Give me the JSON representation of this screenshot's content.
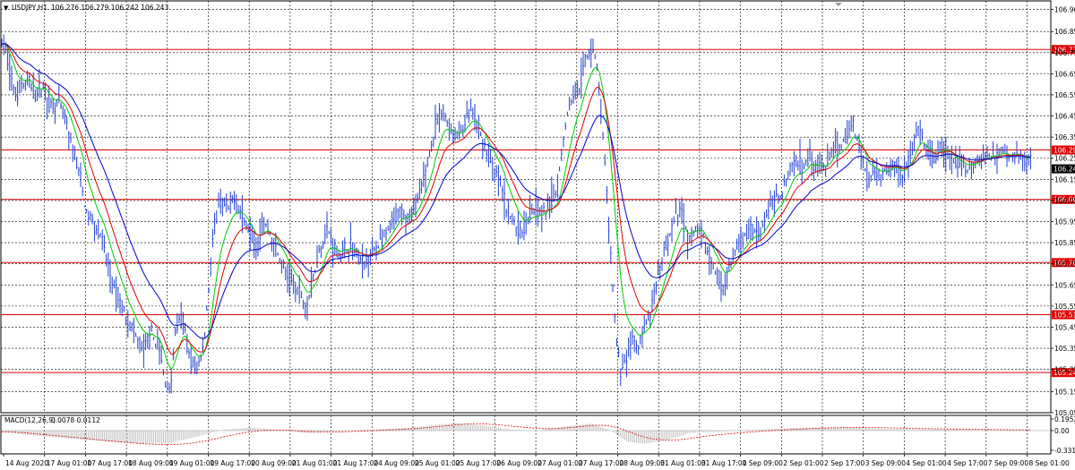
{
  "header": {
    "symbol_label": "USDJPY,H1",
    "ohlc": "106.276 106.279 106.242 106.243",
    "indicator_label": "MACD(12,26,9)",
    "indicator_values": "0.0078 0.0112"
  },
  "colors": {
    "candles": "#1f3fd0",
    "ma_fast": "#00cc00",
    "ma_mid": "#e00000",
    "ma_slow": "#0000cc",
    "levels": "#e00000",
    "grid": "#000000",
    "macd_hist": "#bdbdbd",
    "macd_signal": "#e00000"
  },
  "chart_data": [
    {
      "type": "line",
      "title": "USDJPY,H1",
      "ylim": [
        105.05,
        107.0
      ],
      "y_ticks": [
        "106.960",
        "106.855",
        "106.755",
        "106.655",
        "106.555",
        "106.455",
        "106.355",
        "106.255",
        "106.155",
        "106.055",
        "105.955",
        "105.855",
        "105.755",
        "105.655",
        "105.555",
        "105.455",
        "105.355",
        "105.255",
        "105.150",
        "105.050"
      ],
      "x_ticks": [
        "14 Aug 2020",
        "17 Aug 01:00",
        "17 Aug 17:00",
        "18 Aug 09:00",
        "19 Aug 01:00",
        "19 Aug 17:00",
        "20 Aug 09:00",
        "21 Aug 01:00",
        "21 Aug 17:00",
        "24 Aug 09:00",
        "25 Aug 01:00",
        "25 Aug 17:00",
        "26 Aug 09:00",
        "27 Aug 01:00",
        "27 Aug 17:00",
        "28 Aug 09:00",
        "31 Aug 01:00",
        "31 Aug 17:00",
        "1 Sep 09:00",
        "2 Sep 01:00",
        "2 Sep 17:00",
        "3 Sep 09:00",
        "4 Sep 01:00",
        "4 Sep 17:00",
        "7 Sep 09:00",
        "8 Sep 01:00"
      ],
      "levels": [
        {
          "value": 106.77,
          "label": "106.770"
        },
        {
          "value": 106.294,
          "label": "106.294"
        },
        {
          "value": 106.06,
          "label": "106.060"
        },
        {
          "value": 105.761,
          "label": "105.761"
        },
        {
          "value": 105.514,
          "label": "105.514"
        },
        {
          "value": 105.24,
          "label": "105.240"
        }
      ],
      "current_price": {
        "value": 106.243,
        "label": "106.243"
      },
      "price_path": [
        [
          0,
          106.82
        ],
        [
          8,
          106.75
        ],
        [
          16,
          106.55
        ],
        [
          24,
          106.6
        ],
        [
          32,
          106.62
        ],
        [
          40,
          106.55
        ],
        [
          48,
          106.6
        ],
        [
          56,
          106.5
        ],
        [
          64,
          106.52
        ],
        [
          72,
          106.45
        ],
        [
          80,
          106.3
        ],
        [
          88,
          106.2
        ],
        [
          96,
          106.0
        ],
        [
          104,
          105.95
        ],
        [
          112,
          105.9
        ],
        [
          120,
          105.75
        ],
        [
          128,
          105.62
        ],
        [
          136,
          105.55
        ],
        [
          144,
          105.48
        ],
        [
          152,
          105.4
        ],
        [
          160,
          105.35
        ],
        [
          168,
          105.42
        ],
        [
          176,
          105.38
        ],
        [
          184,
          105.2
        ],
        [
          190,
          105.15
        ],
        [
          196,
          105.45
        ],
        [
          204,
          105.5
        ],
        [
          212,
          105.3
        ],
        [
          220,
          105.25
        ],
        [
          228,
          105.4
        ],
        [
          234,
          105.7
        ],
        [
          240,
          105.95
        ],
        [
          246,
          106.05
        ],
        [
          254,
          106.0
        ],
        [
          262,
          106.08
        ],
        [
          270,
          105.98
        ],
        [
          278,
          105.92
        ],
        [
          286,
          105.85
        ],
        [
          294,
          105.95
        ],
        [
          302,
          105.9
        ],
        [
          310,
          105.8
        ],
        [
          318,
          105.72
        ],
        [
          326,
          105.66
        ],
        [
          334,
          105.62
        ],
        [
          342,
          105.55
        ],
        [
          350,
          105.7
        ],
        [
          358,
          105.85
        ],
        [
          366,
          105.92
        ],
        [
          374,
          105.82
        ],
        [
          382,
          105.8
        ],
        [
          390,
          105.85
        ],
        [
          398,
          105.8
        ],
        [
          406,
          105.75
        ],
        [
          414,
          105.8
        ],
        [
          422,
          105.85
        ],
        [
          430,
          105.88
        ],
        [
          438,
          105.95
        ],
        [
          446,
          106.0
        ],
        [
          454,
          105.98
        ],
        [
          462,
          106.0
        ],
        [
          470,
          106.1
        ],
        [
          478,
          106.25
        ],
        [
          486,
          106.4
        ],
        [
          494,
          106.48
        ],
        [
          502,
          106.4
        ],
        [
          510,
          106.35
        ],
        [
          518,
          106.42
        ],
        [
          526,
          106.48
        ],
        [
          534,
          106.38
        ],
        [
          542,
          106.3
        ],
        [
          550,
          106.2
        ],
        [
          558,
          106.15
        ],
        [
          566,
          106.0
        ],
        [
          574,
          105.95
        ],
        [
          582,
          105.9
        ],
        [
          590,
          106.0
        ],
        [
          598,
          106.02
        ],
        [
          606,
          105.98
        ],
        [
          614,
          106.05
        ],
        [
          622,
          106.1
        ],
        [
          630,
          106.4
        ],
        [
          638,
          106.55
        ],
        [
          646,
          106.6
        ],
        [
          654,
          106.72
        ],
        [
          662,
          106.8
        ],
        [
          668,
          106.62
        ],
        [
          674,
          106.3
        ],
        [
          680,
          105.9
        ],
        [
          686,
          105.5
        ],
        [
          692,
          105.25
        ],
        [
          698,
          105.3
        ],
        [
          704,
          105.4
        ],
        [
          712,
          105.35
        ],
        [
          720,
          105.45
        ],
        [
          728,
          105.55
        ],
        [
          736,
          105.7
        ],
        [
          744,
          105.85
        ],
        [
          752,
          105.95
        ],
        [
          760,
          106.02
        ],
        [
          768,
          105.85
        ],
        [
          776,
          105.92
        ],
        [
          784,
          105.88
        ],
        [
          792,
          105.78
        ],
        [
          800,
          105.7
        ],
        [
          808,
          105.65
        ],
        [
          816,
          105.75
        ],
        [
          824,
          105.85
        ],
        [
          832,
          105.88
        ],
        [
          840,
          105.92
        ],
        [
          848,
          105.9
        ],
        [
          856,
          106.0
        ],
        [
          864,
          106.05
        ],
        [
          872,
          106.1
        ],
        [
          880,
          106.18
        ],
        [
          888,
          106.25
        ],
        [
          896,
          106.22
        ],
        [
          904,
          106.28
        ],
        [
          912,
          106.22
        ],
        [
          920,
          106.2
        ],
        [
          928,
          106.28
        ],
        [
          936,
          106.3
        ],
        [
          944,
          106.35
        ],
        [
          952,
          106.42
        ],
        [
          960,
          106.3
        ],
        [
          968,
          106.15
        ],
        [
          976,
          106.2
        ],
        [
          984,
          106.18
        ],
        [
          992,
          106.2
        ],
        [
          1000,
          106.22
        ],
        [
          1008,
          106.18
        ],
        [
          1016,
          106.25
        ],
        [
          1024,
          106.4
        ],
        [
          1032,
          106.3
        ],
        [
          1040,
          106.25
        ],
        [
          1048,
          106.28
        ],
        [
          1056,
          106.3
        ],
        [
          1064,
          106.22
        ],
        [
          1072,
          106.25
        ],
        [
          1080,
          106.2
        ],
        [
          1088,
          106.22
        ],
        [
          1096,
          106.28
        ],
        [
          1104,
          106.25
        ],
        [
          1112,
          106.28
        ],
        [
          1120,
          106.3
        ],
        [
          1128,
          106.26
        ],
        [
          1136,
          106.26
        ],
        [
          1144,
          106.25
        ],
        [
          1152,
          106.243
        ]
      ],
      "ma_periods": [
        5,
        9,
        17
      ]
    },
    {
      "type": "bar",
      "title": "MACD(12,26,9)",
      "ylim": [
        -0.3314,
        0.1952
      ],
      "y_ticks": [
        "0.1952",
        "0.00",
        "-0.3314"
      ],
      "macd_path": [
        [
          0,
          -0.02
        ],
        [
          40,
          -0.1
        ],
        [
          80,
          -0.16
        ],
        [
          120,
          -0.22
        ],
        [
          160,
          -0.26
        ],
        [
          190,
          -0.24
        ],
        [
          220,
          -0.12
        ],
        [
          250,
          0.02
        ],
        [
          280,
          0.06
        ],
        [
          310,
          0.01
        ],
        [
          340,
          -0.05
        ],
        [
          370,
          -0.02
        ],
        [
          400,
          0.01
        ],
        [
          430,
          0.03
        ],
        [
          460,
          0.06
        ],
        [
          490,
          0.12
        ],
        [
          510,
          0.15
        ],
        [
          540,
          0.1
        ],
        [
          570,
          0.02
        ],
        [
          600,
          0.0
        ],
        [
          630,
          0.08
        ],
        [
          660,
          0.14
        ],
        [
          680,
          0.02
        ],
        [
          700,
          -0.22
        ],
        [
          720,
          -0.26
        ],
        [
          745,
          -0.18
        ],
        [
          770,
          -0.05
        ],
        [
          800,
          -0.02
        ],
        [
          830,
          0.01
        ],
        [
          860,
          0.03
        ],
        [
          890,
          0.05
        ],
        [
          920,
          0.06
        ],
        [
          950,
          0.06
        ],
        [
          980,
          0.04
        ],
        [
          1010,
          0.03
        ],
        [
          1040,
          0.02
        ],
        [
          1070,
          0.02
        ],
        [
          1100,
          0.01
        ],
        [
          1130,
          0.01
        ],
        [
          1152,
          0.0078
        ]
      ]
    }
  ]
}
